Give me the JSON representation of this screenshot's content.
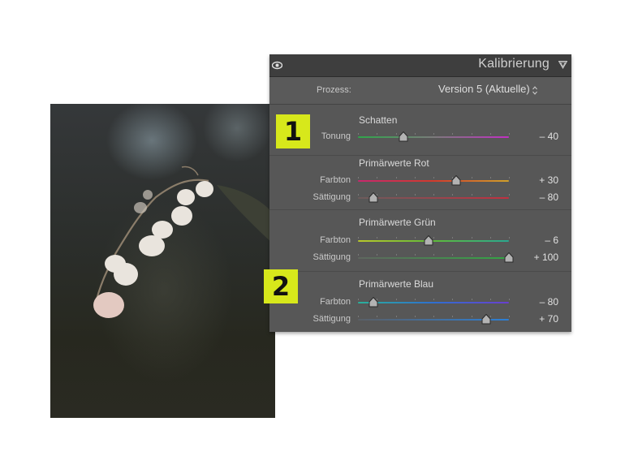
{
  "panel": {
    "title": "Kalibrierung",
    "process": {
      "label": "Prozess:",
      "value": "Version 5 (Aktuelle)"
    },
    "sections": [
      {
        "title": "Schatten",
        "sliders": [
          {
            "label": "Tonung",
            "value_text": "– 40",
            "value": -40,
            "track": "linear-gradient(90deg,#2ea74a,#7b7b7b 50%,#c22fc4)"
          }
        ]
      },
      {
        "title": "Primärwerte Rot",
        "sliders": [
          {
            "label": "Farbton",
            "value_text": "+ 30",
            "value": 30,
            "track": "linear-gradient(90deg,#c8286e,#d23a2c 50%,#d1a12a)"
          },
          {
            "label": "Sättigung",
            "value_text": "– 80",
            "value": -80,
            "track": "linear-gradient(90deg,#6b5c5c,#c23040)"
          }
        ]
      },
      {
        "title": "Primärwerte Grün",
        "sliders": [
          {
            "label": "Farbton",
            "value_text": "– 6",
            "value": -6,
            "track": "linear-gradient(90deg,#b9c82a,#5fba3a 50%,#2aa890)"
          },
          {
            "label": "Sättigung",
            "value_text": "+ 100",
            "value": 100,
            "track": "linear-gradient(90deg,#5f665f,#33a544)"
          }
        ]
      },
      {
        "title": "Primärwerte Blau",
        "sliders": [
          {
            "label": "Farbton",
            "value_text": "– 80",
            "value": -80,
            "track": "linear-gradient(90deg,#2bb09a,#2f6fd0 50%,#6a3fd0)"
          },
          {
            "label": "Sättigung",
            "value_text": "+ 70",
            "value": 70,
            "track": "linear-gradient(90deg,#5a5f66,#2c7fd6)"
          }
        ]
      }
    ]
  },
  "badges": [
    "1",
    "2"
  ],
  "colors": {
    "badge": "#d7e81b",
    "panel_bg": "#575757",
    "header_bg": "#3e3e3e"
  },
  "icons": {
    "visibility": "eye-icon",
    "collapse": "triangle-down-icon",
    "select": "updown-arrows-icon"
  }
}
